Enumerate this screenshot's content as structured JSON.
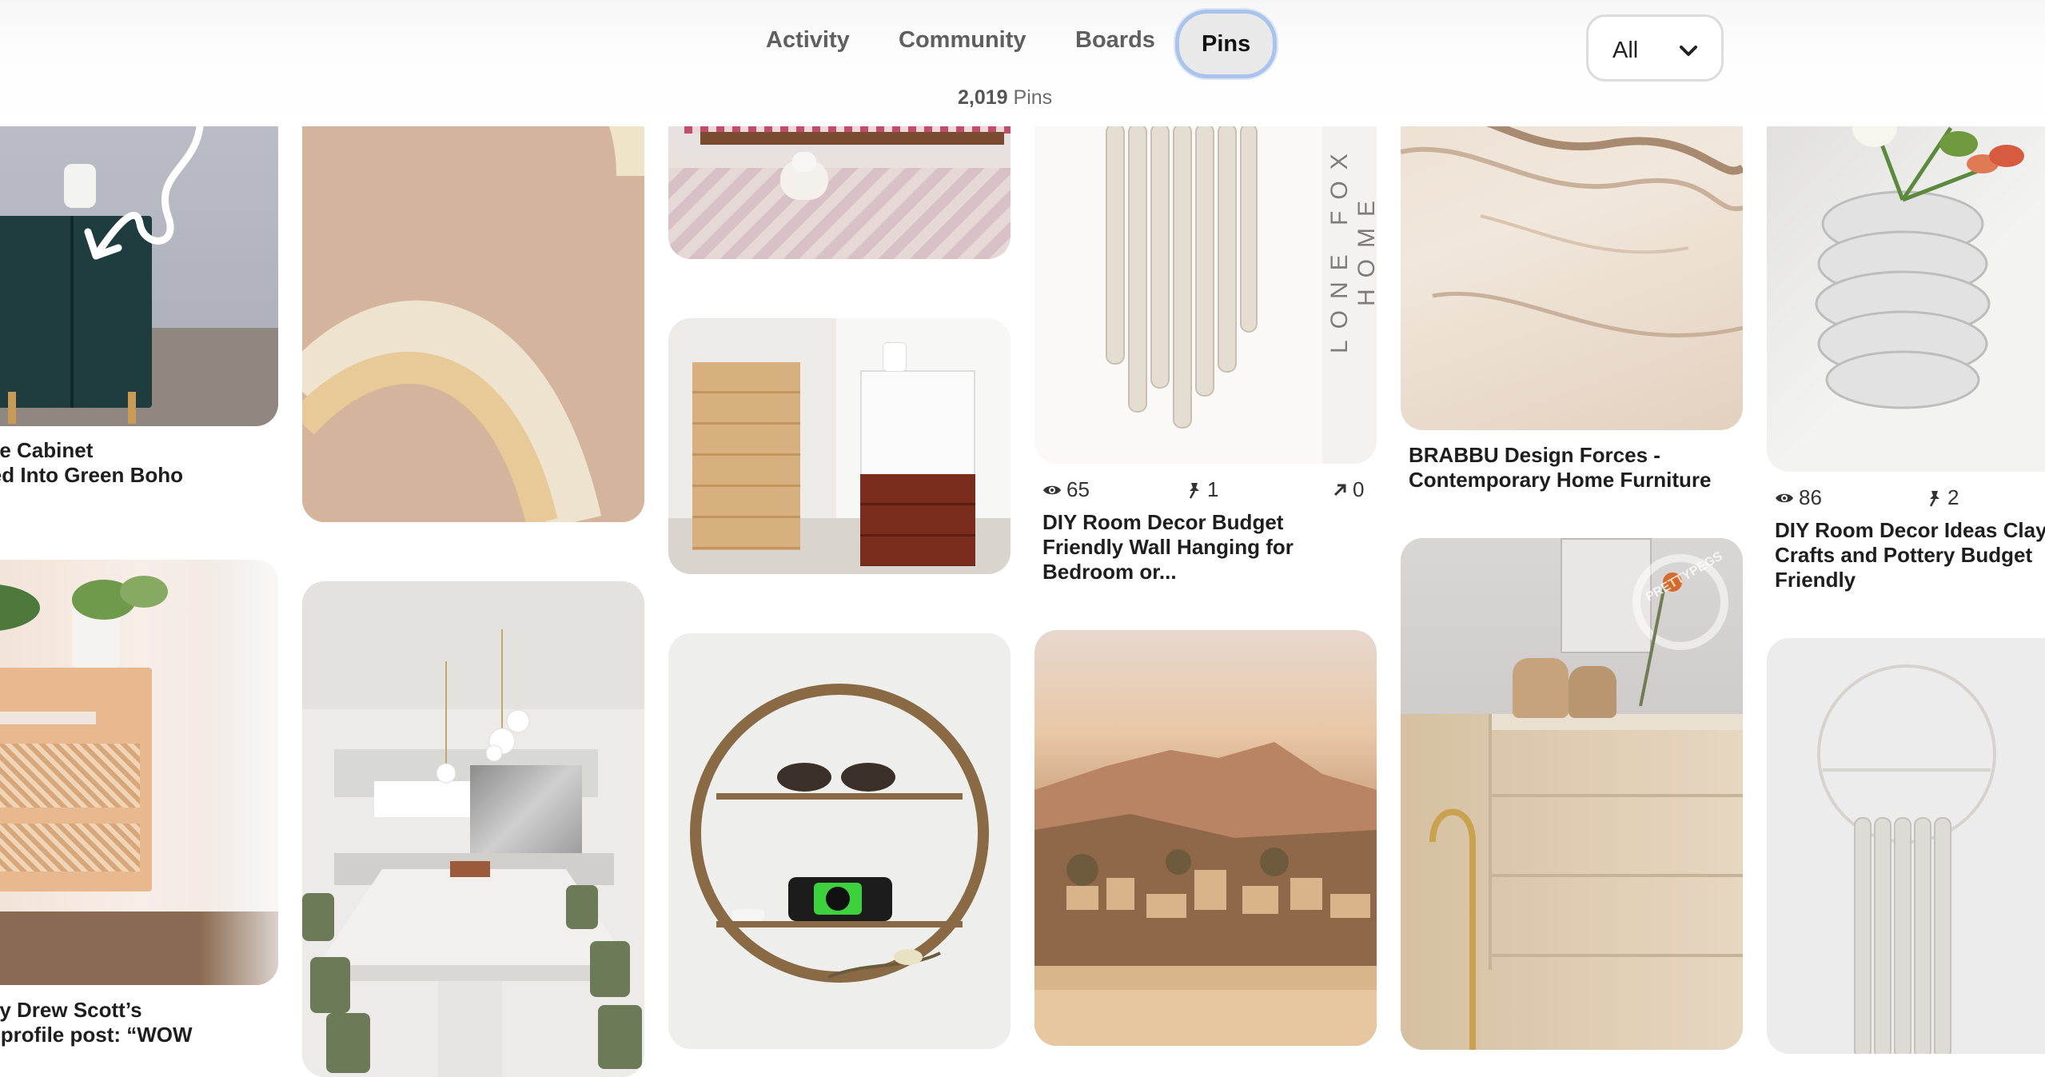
{
  "header": {
    "tabs": [
      {
        "label": "Activity",
        "active": false
      },
      {
        "label": "Community",
        "active": false
      },
      {
        "label": "Boards",
        "active": false
      },
      {
        "label": "Pins",
        "active": true
      }
    ],
    "pin_count": "2,019",
    "pin_count_label": "Pins",
    "filter": {
      "selected": "All",
      "icon": "chevron-down-icon"
    }
  },
  "pins": {
    "c1a": {
      "title_lines": [
        "minate Cabinet",
        "formed Into Green Boho",
        "..."
      ]
    },
    "c1b": {
      "title_lines": [
        "Fox by Drew Scott’s",
        "gram profile post: “WOW"
      ]
    },
    "c4a": {
      "views": "65",
      "saves": "1",
      "shares": "0",
      "title_lines": [
        "DIY Room Decor Budget",
        "Friendly Wall Hanging for",
        "Bedroom or..."
      ],
      "watermark": "LONE FOX HOME"
    },
    "c5a": {
      "title_lines": [
        "BRABBU Design Forces -",
        "Contemporary Home Furniture"
      ]
    },
    "c5b": {
      "watermark": "PRETTYPEGS"
    },
    "c6a": {
      "views": "86",
      "saves": "2",
      "title_lines": [
        "DIY Room Decor Ideas Clay",
        "Crafts and Pottery Budget",
        "Friendly"
      ]
    }
  },
  "icons": [
    "eye-icon",
    "pin-icon",
    "share-arrow-icon",
    "chevron-down-icon"
  ],
  "colors": {
    "active_tab_ring": "#a9c3ea",
    "active_tab_bg": "#e9e9e9",
    "text_muted": "#6b6b6b"
  }
}
